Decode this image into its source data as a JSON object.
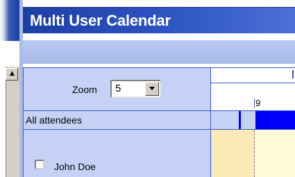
{
  "window": {
    "title": "Multi User Calendar"
  },
  "toolbar": {
    "zoom_label": "Zoom",
    "zoom_value": "5"
  },
  "rows": {
    "attendees_label": "All attendees",
    "users": [
      {
        "name": "John Doe",
        "checked": false
      }
    ]
  },
  "timeline": {
    "hour_labels": [
      "9"
    ]
  },
  "colors": {
    "title_bar": "#2f55c4",
    "header_band": "#b0c2ee",
    "grid_line": "#3a5abf",
    "busy": "#0000ff",
    "off_hours": "#fde8b8",
    "work_hours": "#fffbd9"
  },
  "icons": {
    "zoom_dropdown": "chevron-down-icon",
    "scroll_arrow": "triangle-up-icon"
  }
}
